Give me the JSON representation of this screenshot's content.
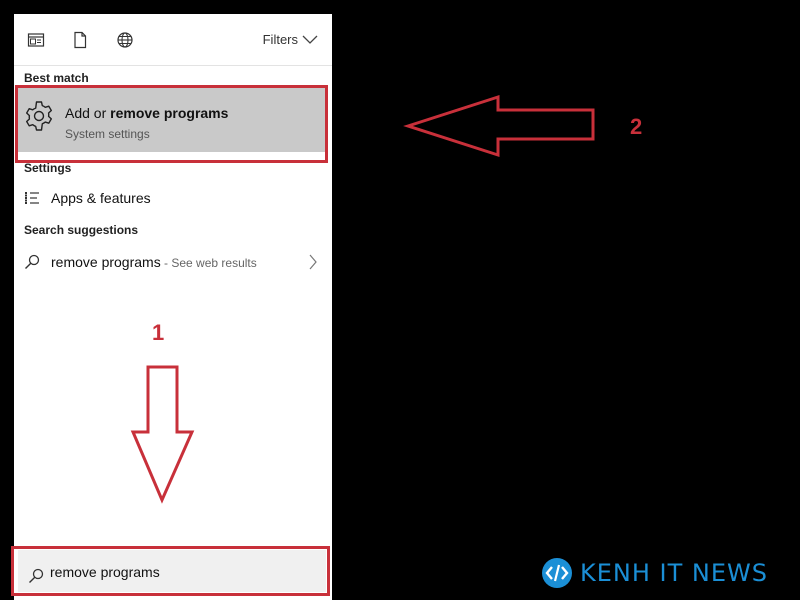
{
  "toolbar": {
    "icons": [
      "apps-icon",
      "document-icon",
      "web-icon"
    ],
    "filters_label": "Filters"
  },
  "best_match": {
    "section_title": "Best match",
    "title_prefix": "Add or ",
    "title_bold": "remove programs",
    "subtitle": "System settings"
  },
  "settings": {
    "section_title": "Settings",
    "items": [
      {
        "label": "Apps & features",
        "icon": "list-icon"
      }
    ]
  },
  "suggestions": {
    "section_title": "Search suggestions",
    "items": [
      {
        "label": "remove programs",
        "suffix": " - See web results",
        "icon": "search-icon"
      }
    ]
  },
  "search": {
    "value": "remove programs"
  },
  "annotations": {
    "step1": "1",
    "step2": "2",
    "color": "#c8303a"
  },
  "watermark": {
    "text": "KENH IT NEWS",
    "color": "#1b8fd6"
  }
}
